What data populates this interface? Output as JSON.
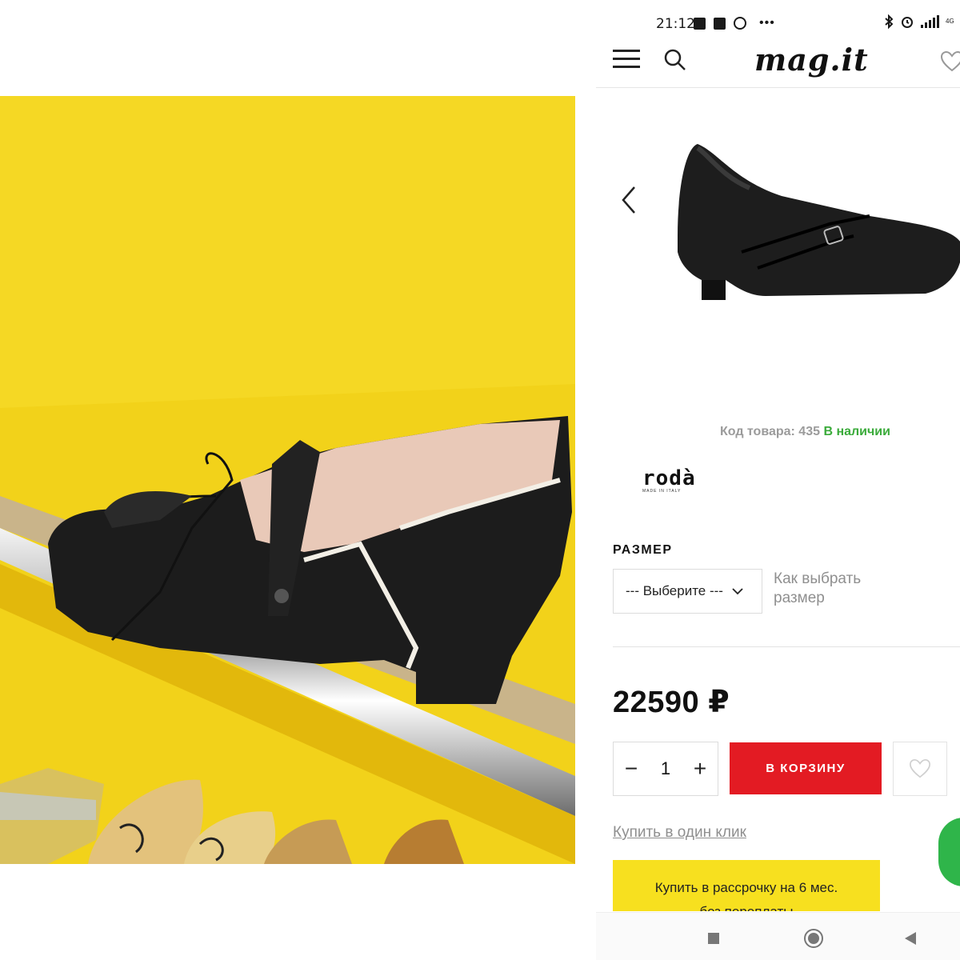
{
  "status_bar": {
    "time": "21:12",
    "network": "4G"
  },
  "header": {
    "logo": "mag.it"
  },
  "product": {
    "sku_label": "Код товара: 435",
    "stock": "В наличии",
    "brand": "rodà",
    "brand_tagline": "MADE IN ITALY",
    "size_title": "РАЗМЕР",
    "size_select_value": "--- Выберите ---",
    "size_help": "Как выбрать размер",
    "price": "22590 ₽",
    "quantity": "1",
    "add_to_cart": "В КОРЗИНУ",
    "one_click": "Купить в один клик",
    "installment_line1": "Купить в рассрочку на 6 мес.",
    "installment_line2": "без переплаты"
  },
  "colors": {
    "accent_red": "#e31b23",
    "stock_green": "#3bab3b",
    "installment_yellow": "#f7e01f",
    "fab_green": "#2fb54a",
    "photo_yellow": "#f2d21a"
  },
  "icons": [
    "menu-icon",
    "search-icon",
    "heart-icon",
    "chevron-left-icon",
    "chevron-down-icon",
    "minus-icon",
    "plus-icon",
    "bluetooth-icon",
    "alarm-icon",
    "signal-icon"
  ]
}
